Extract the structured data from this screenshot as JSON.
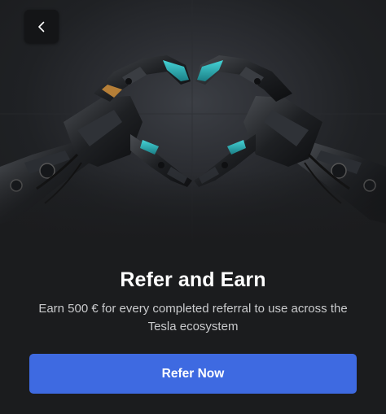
{
  "header": {
    "back_icon": "chevron-left-icon"
  },
  "hero": {
    "image": "robot-hands-heart",
    "accent_color": "#2fb7bd"
  },
  "main": {
    "title": "Refer and Earn",
    "subtitle": "Earn 500 € for every completed referral to use across the Tesla ecosystem",
    "cta_label": "Refer Now"
  },
  "colors": {
    "background": "#1b1c1e",
    "primary_button": "#3e6ae1",
    "title_text": "#ffffff",
    "body_text": "#c9cacc"
  }
}
